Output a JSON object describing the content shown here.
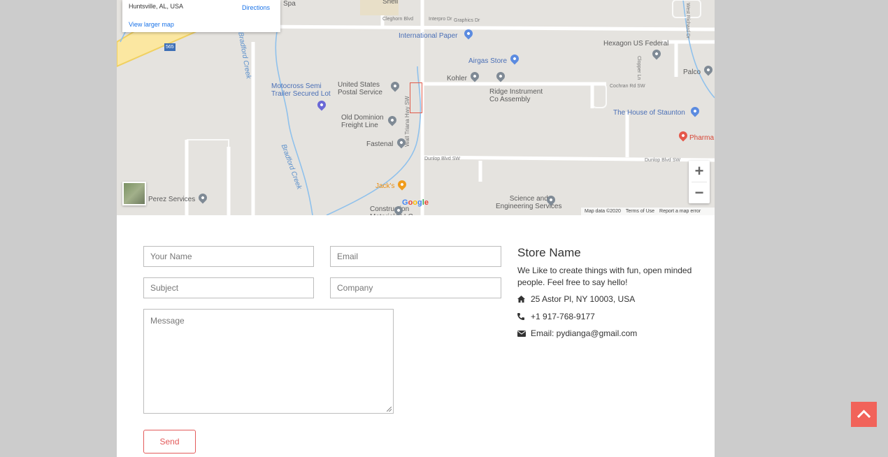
{
  "map": {
    "info_card": {
      "address": "Huntsville, AL, USA",
      "directions": "Directions",
      "view_larger": "View larger map"
    },
    "labels": {
      "spa": "Spa",
      "shell": "Shell",
      "cleghorn": "Cleghorn Blvd",
      "interpro": "Interpro Dr",
      "graphics": "Graphics Dr",
      "international_paper": "International Paper",
      "airgas": "Airgas Store",
      "hexagon": "Hexagon US Federal",
      "palco": "Palco",
      "kohler": "Kohler",
      "cochran": "Cochran Rd SW",
      "ridge": "Ridge Instrument\nCo Assembly",
      "usps": "United States\nPostal Service",
      "motocross": "Motocross Semi\nTrailer Secured Lot",
      "house_staunton": "The House of Staunton",
      "pharma": "Pharma",
      "old_dominion": "Old Dominion\nFreight Line",
      "fastenal": "Fastenal",
      "wall_triana": "Wall Triana Hwy SW",
      "dunlop1": "Dunlop Blvd SW",
      "dunlop2": "Dunlop Blvd SW",
      "jacks": "Jack's",
      "perez": "Perez Services",
      "science": "Science and\nEngineering Services",
      "construction": "Construction\nMaterials LLC",
      "bradford1": "Bradford Creek",
      "bradford2": "Bradford Creek",
      "chapel": "Clopper Ln",
      "highway": "565",
      "west_richard": "West Richard Dr"
    },
    "zoom_in": "+",
    "zoom_out": "−",
    "google": [
      "G",
      "o",
      "o",
      "g",
      "l",
      "e"
    ],
    "footer": {
      "map_data": "Map data ©2020",
      "terms": "Terms of Use",
      "report": "Report a map error"
    }
  },
  "form": {
    "name_placeholder": "Your Name",
    "email_placeholder": "Email",
    "subject_placeholder": "Subject",
    "company_placeholder": "Company",
    "message_placeholder": "Message",
    "send_label": "Send"
  },
  "store": {
    "title": "Store Name",
    "description": "We Like to create things with fun, open minded people. Feel free to say hello!",
    "address": "25 Astor Pl, NY 10003, USA",
    "phone": "+1 917-768-9177",
    "email": "Email: pydianga@gmail.com"
  },
  "colors": {
    "accent": "#e35b5b",
    "back_to_top": "#f1635a",
    "page_bg": "#cccccc"
  }
}
